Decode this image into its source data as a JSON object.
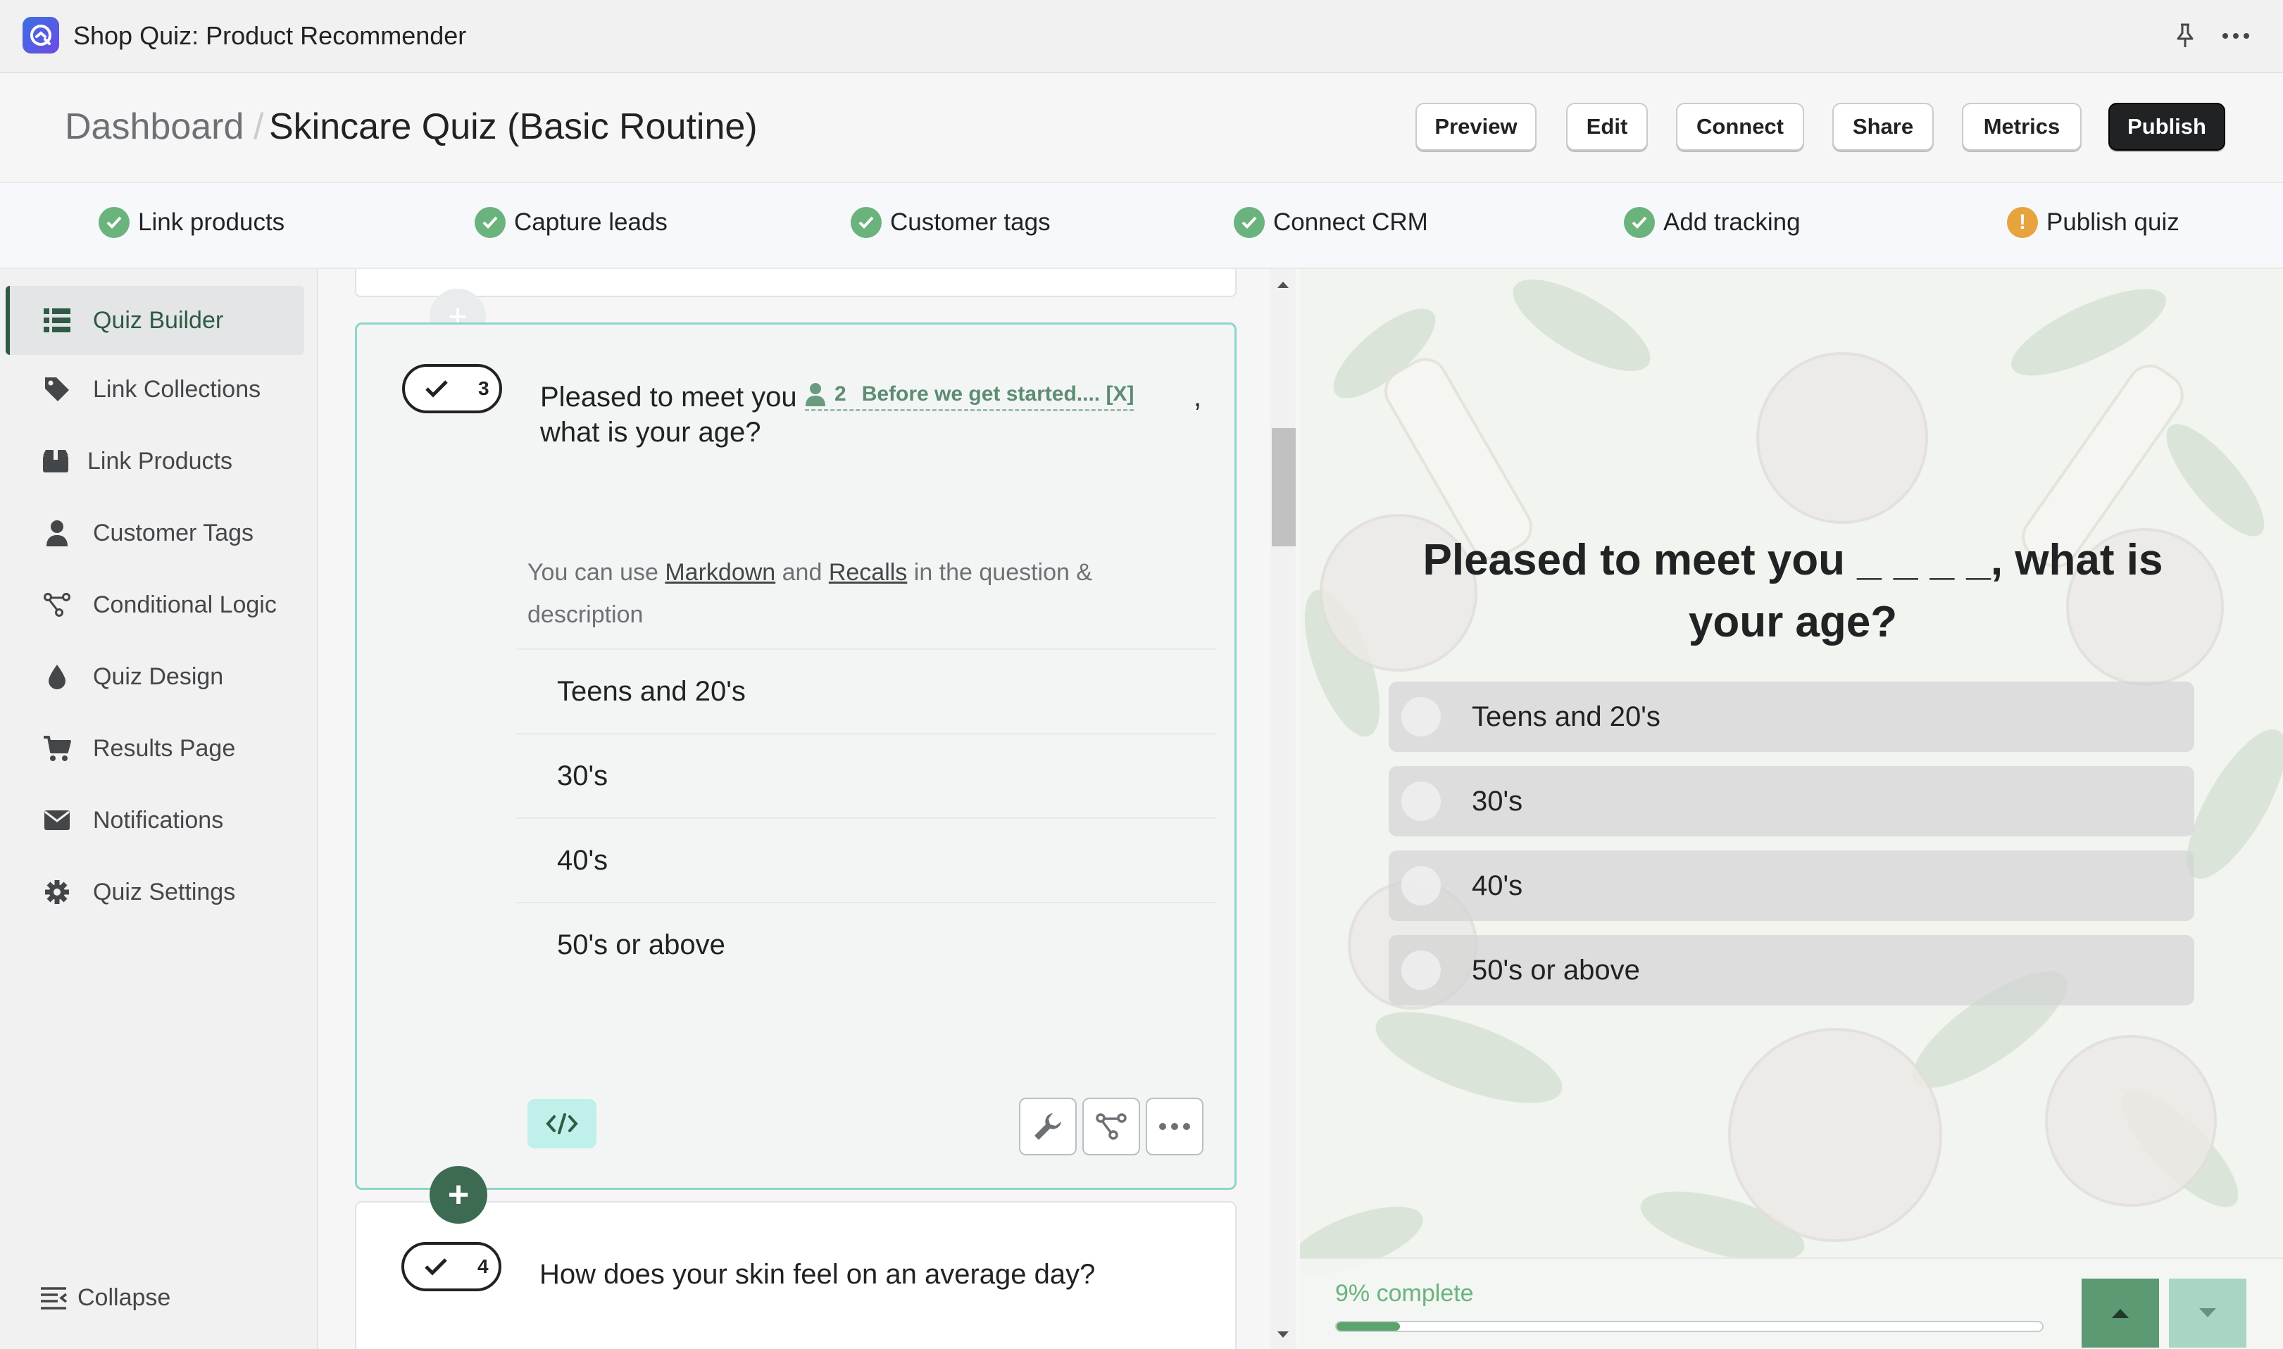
{
  "app": {
    "title": "Shop Quiz: Product Recommender"
  },
  "header": {
    "breadcrumb_root": "Dashboard",
    "breadcrumb_sep": "/",
    "page_title": "Skincare Quiz (Basic Routine)",
    "buttons": {
      "preview": "Preview",
      "edit": "Edit",
      "connect": "Connect",
      "share": "Share",
      "metrics": "Metrics",
      "publish": "Publish"
    }
  },
  "steps": [
    {
      "label": "Link products",
      "status": "complete"
    },
    {
      "label": "Capture leads",
      "status": "complete"
    },
    {
      "label": "Customer tags",
      "status": "complete"
    },
    {
      "label": "Connect CRM",
      "status": "complete"
    },
    {
      "label": "Add tracking",
      "status": "complete"
    },
    {
      "label": "Publish quiz",
      "status": "warning"
    }
  ],
  "sidebar": {
    "items": [
      {
        "label": "Quiz Builder",
        "icon": "list-icon",
        "active": true
      },
      {
        "label": "Link Collections",
        "icon": "tag-icon"
      },
      {
        "label": "Link Products",
        "icon": "box-icon"
      },
      {
        "label": "Customer Tags",
        "icon": "person-icon"
      },
      {
        "label": "Conditional Logic",
        "icon": "branch-icon"
      },
      {
        "label": "Quiz Design",
        "icon": "droplet-icon"
      },
      {
        "label": "Results Page",
        "icon": "cart-icon"
      },
      {
        "label": "Notifications",
        "icon": "envelope-icon"
      },
      {
        "label": "Quiz Settings",
        "icon": "gear-icon"
      }
    ],
    "collapse_label": "Collapse"
  },
  "editor": {
    "question": {
      "number": "3",
      "text_before": "Pleased to meet you",
      "recall_index": "2",
      "recall_label": "Before we get started.... [X]",
      "text_comma": ",",
      "text_after": "what is your age?",
      "hint_prefix": "You can use ",
      "hint_markdown": "Markdown",
      "hint_and": " and ",
      "hint_recalls": "Recalls",
      "hint_suffix": " in the question & description",
      "answers": [
        "Teens and 20's",
        "30's",
        "40's",
        "50's or above"
      ]
    },
    "next_question": {
      "number": "4",
      "text": "How does your skin feel on an average day?"
    }
  },
  "preview": {
    "question": "Pleased to meet you _ _ _ _, what is your age?",
    "options": [
      "Teens and 20's",
      "30's",
      "40's",
      "50's or above"
    ],
    "progress_text": "9% complete",
    "progress_fraction": 0.09
  },
  "colors": {
    "accent": "#2f5a45",
    "step_check": "#6ab37c",
    "step_warn": "#e7a33e",
    "card_border": "#8fd4c9",
    "publish_bg": "#202223"
  }
}
